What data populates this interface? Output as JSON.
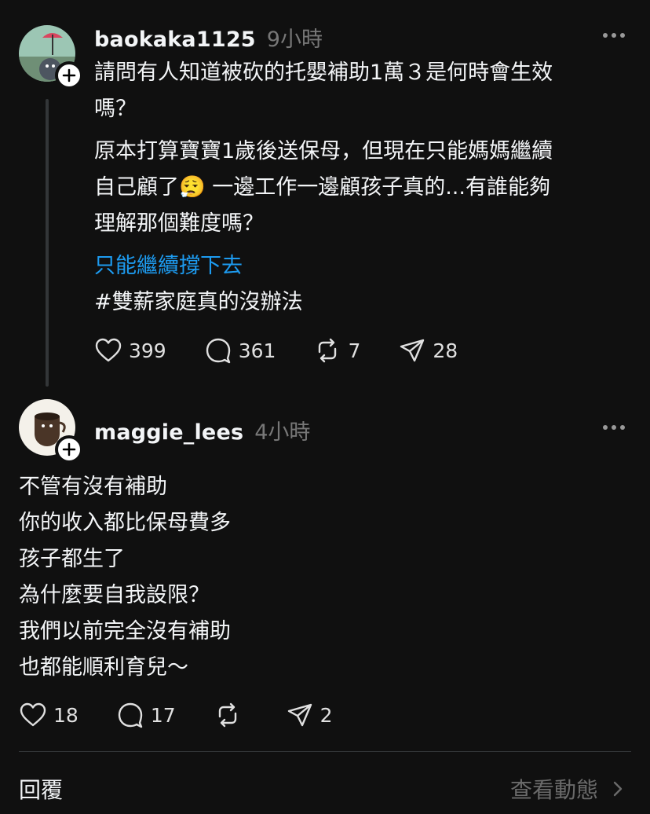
{
  "posts": [
    {
      "username": "baokaka1125",
      "time": "9小時",
      "paragraph1": [
        "請問有人知道被砍的托嬰補助1萬３是何時會生效",
        "嗎？"
      ],
      "paragraph2": [
        "原本打算寶寶1歲後送保母，但現在只能媽媽繼續",
        "自己顧了😮‍💨 一邊工作一邊顧孩子真的...有誰能夠",
        "理解那個難度嗎？"
      ],
      "link": "只能繼續撐下去",
      "hashtag": "#雙薪家庭真的沒辦法",
      "likes": "399",
      "comments": "361",
      "reposts": "7",
      "shares": "28"
    },
    {
      "username": "maggie_lees",
      "time": "4小時",
      "lines": [
        "不管有沒有補助",
        "你的收入都比保母費多",
        "孩子都生了",
        "為什麼要自我設限？",
        "我們以前完全沒有補助",
        "也都能順利育兒～"
      ],
      "likes": "18",
      "comments": "17",
      "reposts": "",
      "shares": "2"
    }
  ],
  "footer": {
    "reply_label": "回覆",
    "view_activity_label": "查看動態"
  },
  "colors": {
    "background": "#101010",
    "link": "#1d9bf0",
    "muted": "#777777"
  },
  "icons": [
    "plus-icon",
    "more-icon",
    "heart-icon",
    "comment-icon",
    "repost-icon",
    "share-icon",
    "chevron-right-icon"
  ]
}
